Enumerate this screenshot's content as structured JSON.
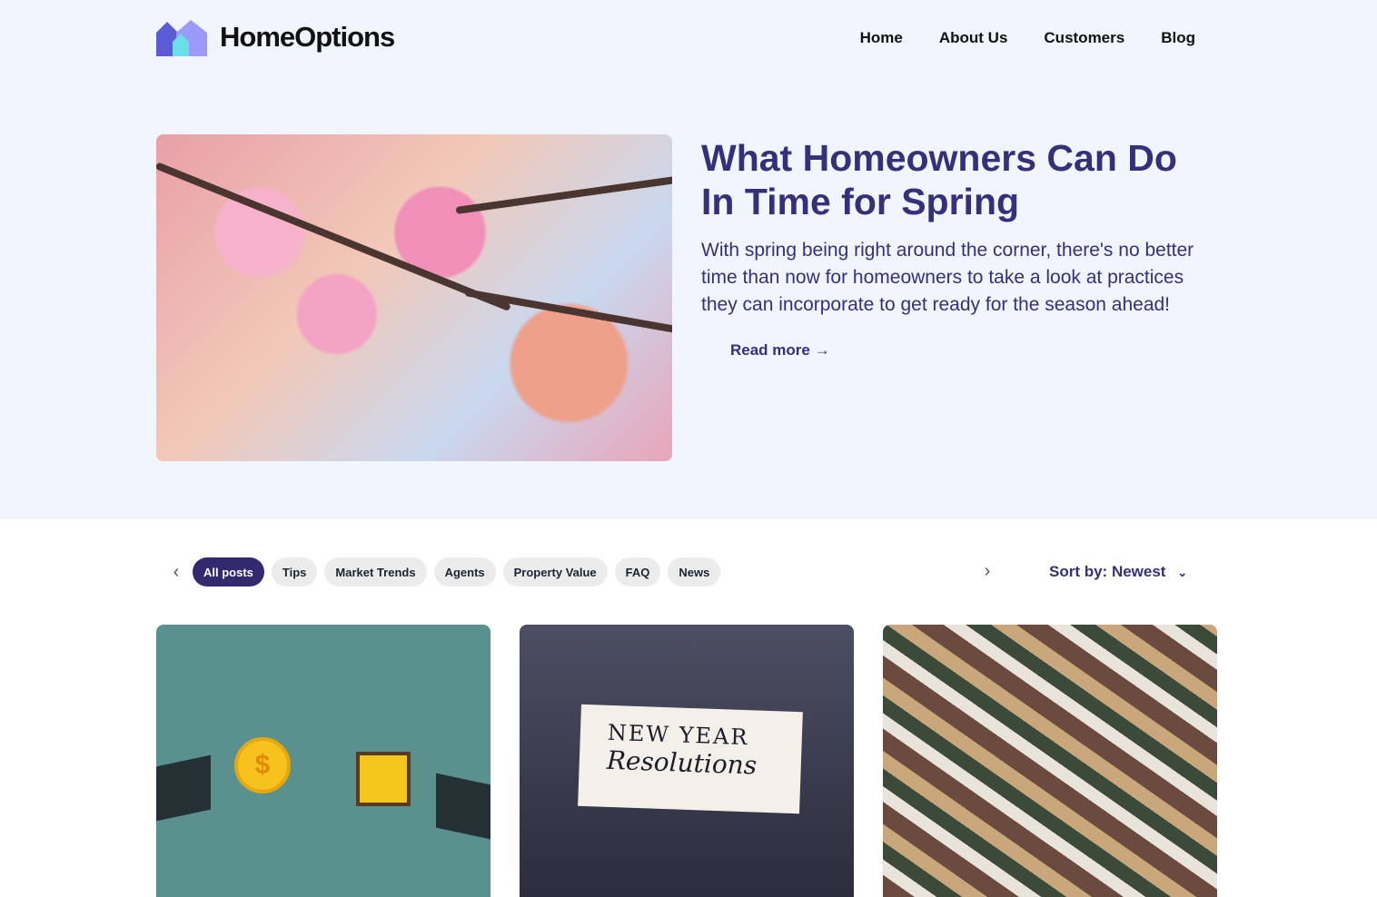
{
  "brand": {
    "name": "HomeOptions"
  },
  "nav": [
    "Home",
    "About Us",
    "Customers",
    "Blog"
  ],
  "hero": {
    "title": "What Homeowners Can Do In Time for Spring",
    "description": "With spring being right around the corner, there's no better time than now for homeowners to take a look at practices they can incorporate to get ready for the season ahead!",
    "read_more": "Read more"
  },
  "filters": {
    "items": [
      "All posts",
      "Tips",
      "Market Trends",
      "Agents",
      "Property Value",
      "FAQ",
      "News"
    ],
    "active": "All posts",
    "sort": "Sort by: Newest"
  },
  "cards": [
    {
      "image": "hands exchanging coin and house"
    },
    {
      "image": "note card",
      "note_line1": "NEW YEAR",
      "note_line2": "Resolutions"
    },
    {
      "image": "aerial view of houses"
    }
  ],
  "colors": {
    "accent": "#33296f",
    "hero_bg": "#f1f5fe"
  }
}
